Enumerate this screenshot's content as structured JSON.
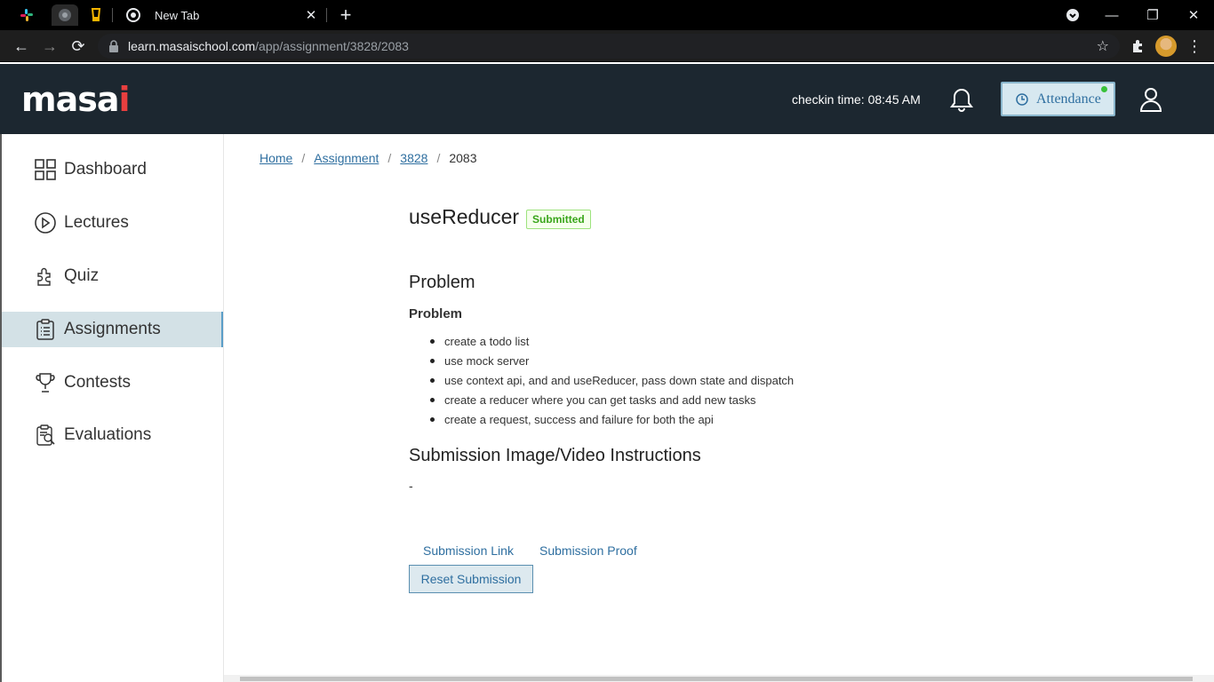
{
  "browser": {
    "tab_title": "New Tab",
    "url_host": "learn.masaischool.com",
    "url_path": "/app/assignment/3828/2083",
    "tab_icons": [
      "slack-icon",
      "chrome-icon",
      "keep-icon",
      "chrome-icon"
    ]
  },
  "header": {
    "logo_text": "masa",
    "logo_accent": "i",
    "checkin_text": "checkin time: 08:45 AM",
    "attendance_label": "Attendance",
    "accent_color": "#e83f3f"
  },
  "sidebar": {
    "items": [
      {
        "label": "Dashboard",
        "icon": "grid-icon"
      },
      {
        "label": "Lectures",
        "icon": "play-circle-icon"
      },
      {
        "label": "Quiz",
        "icon": "puzzle-icon"
      },
      {
        "label": "Assignments",
        "icon": "clipboard-icon",
        "active": true
      },
      {
        "label": "Contests",
        "icon": "trophy-icon"
      },
      {
        "label": "Evaluations",
        "icon": "evaluation-icon"
      }
    ]
  },
  "breadcrumb": {
    "home": "Home",
    "assignment": "Assignment",
    "id1": "3828",
    "current": "2083",
    "separator": "/"
  },
  "main": {
    "title": "useReducer",
    "status": "Submitted",
    "problem_heading": "Problem",
    "problem_subheading": "Problem",
    "problem_items": [
      "create a todo list",
      "use mock server",
      "use context api, and and useReducer, pass down state and dispatch",
      "create a reducer where you can get tasks and add new tasks",
      "create a request, success and failure for both the api"
    ],
    "submission_heading": "Submission Image/Video Instructions",
    "submission_text": "-",
    "submission_link_label": "Submission Link",
    "submission_proof_label": "Submission Proof",
    "reset_label": "Reset Submission"
  }
}
